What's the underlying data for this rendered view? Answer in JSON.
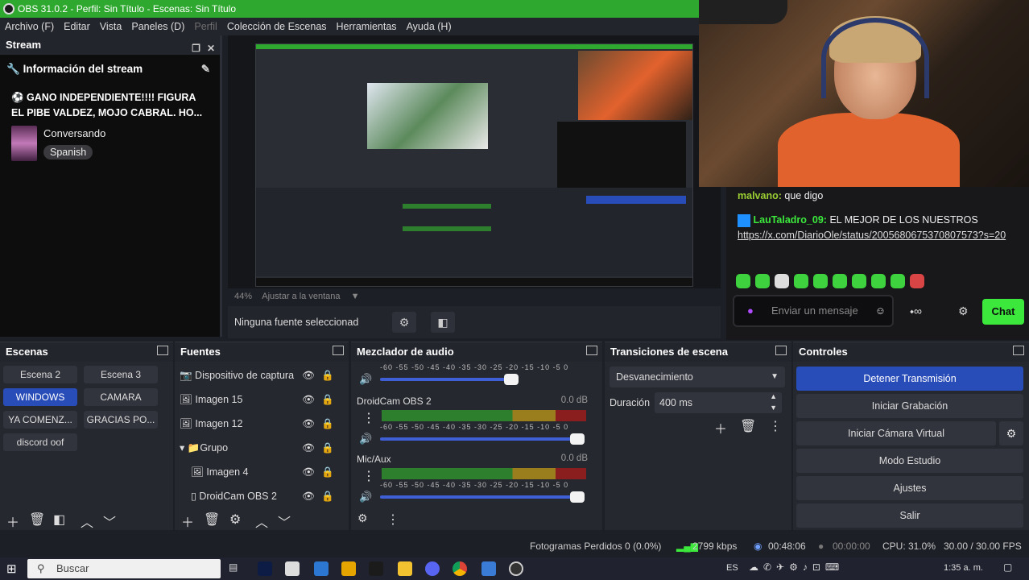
{
  "window": {
    "title": "OBS 31.0.2 - Perfil: Sin Título - Escenas: Sin Título"
  },
  "menu": [
    "Archivo (F)",
    "Editar",
    "Vista",
    "Paneles (D)",
    "Perfil",
    "Colección de Escenas",
    "Herramientas",
    "Ayuda (H)"
  ],
  "stream_dock": {
    "title": "Stream",
    "info_title": "Información del stream",
    "stream_title": "⚽ GANO INDEPENDIENTE!!!! FIGURA EL PIBE VALDEZ, MOJO CABRAL. HO...",
    "category": "Conversando",
    "language": "Spanish"
  },
  "preview": {
    "zoom": "44%",
    "fit_label": "Ajustar a la ventana",
    "no_source": "Ninguna fuente seleccionad"
  },
  "chat": {
    "line1_user": "malvano:",
    "line1_text": "que digo",
    "line2_user": "LauTaladro_09:",
    "line2_text": "EL MEJOR DE LOS NUESTROS",
    "link": "https://x.com/DiarioOle/status/2005680675370807573?s=20",
    "input_placeholder": "Enviar un mensaje",
    "chat_button": "Chat"
  },
  "scenes": {
    "title": "Escenas",
    "items": [
      "Escena 2",
      "Escena 3",
      "WINDOWS",
      "CAMARA",
      "YA COMENZ...",
      "GRACIAS PO...",
      "discord oof"
    ],
    "active": "WINDOWS"
  },
  "sources": {
    "title": "Fuentes",
    "items": [
      "Dispositivo de captura",
      "Imagen 15",
      "Imagen 12",
      "Grupo",
      "Imagen 4",
      "DroidCam OBS 2"
    ]
  },
  "mixer": {
    "title": "Mezclador de audio",
    "ticks": "-60 -55 -50 -45 -40 -35 -30 -25 -20 -15 -10 -5 0",
    "channels": [
      {
        "name": "DroidCam OBS 2",
        "db": "0.0 dB"
      },
      {
        "name": "Mic/Aux",
        "db": "0.0 dB"
      }
    ]
  },
  "transitions": {
    "title": "Transiciones de escena",
    "selected": "Desvanecimiento",
    "duration_label": "Duración",
    "duration_value": "400 ms"
  },
  "controls": {
    "title": "Controles",
    "buttons": [
      "Detener Transmisión",
      "Iniciar Grabación",
      "Iniciar Cámara Virtual",
      "Modo Estudio",
      "Ajustes",
      "Salir"
    ]
  },
  "status": {
    "dropped": "Fotogramas Perdidos 0 (0.0%)",
    "bitrate": "2799 kbps",
    "live_time": "00:48:06",
    "rec_time": "00:00:00",
    "cpu": "CPU: 31.0%",
    "fps": "30.00 / 30.00 FPS"
  },
  "taskbar": {
    "search": "Buscar",
    "lang": "ES",
    "time": "1:35 a. m."
  },
  "colors": {
    "accent": "#284cb8",
    "titlebar": "#2ea82e",
    "chat_button": "#3be83b"
  }
}
